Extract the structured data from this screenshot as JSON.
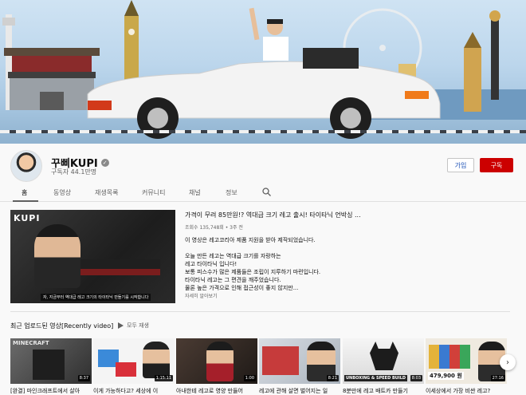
{
  "channel": {
    "name": "꾸삐KUPI",
    "verified_icon": "verified-check-icon",
    "subscribers": "구독자 44.1만명",
    "join_label": "가입",
    "subscribe_label": "구독"
  },
  "tabs": [
    {
      "label": "홈",
      "active": true
    },
    {
      "label": "동영상"
    },
    {
      "label": "재생목록"
    },
    {
      "label": "커뮤니티"
    },
    {
      "label": "채널"
    },
    {
      "label": "정보"
    }
  ],
  "search_icon": "search-icon",
  "featured": {
    "thumb_logo": "KUPI",
    "thumb_caption": "자, 지금부터 역대급 레고 크기의 타이타닉 만들기를 시작합니다",
    "title": "가격이 무려 85만원!? 역대급 크기 레고 출시! 타이타닉 언박싱 ...",
    "meta": "조회수 135,748회 • 3주 전",
    "description": "이 영상은 레고코리아 제품 지원을 받아 제작되었습니다.\n\n오늘 만든 레고는 역대급 크기를 자랑하는\n레고 타이타닉 입니다!\n보통 피스수가 많은 제품들은 조립이 지루하기 마련입니다.\n타이타닉 레고는 그 편견을 깨주었습니다.\n물론 높은 가격으로 인해 접근성이 좋지 않지만...",
    "more": "자세히 알아보기"
  },
  "recent": {
    "title": "최근 업로드된 영상[Recently video]",
    "play_all": "모두 재생",
    "play_icon": "play-icon",
    "next_icon": "chevron-right-icon",
    "videos": [
      {
        "title": "[완결] 마인크래프트에서 살아",
        "duration": "8:37",
        "thumb_text": "MINECRAFT"
      },
      {
        "title": "이게 가능하다고? 세상에 이",
        "duration": "1:15:11",
        "thumb_text": ""
      },
      {
        "title": "아내한테 레고로 영양 만들어",
        "duration": "1:00",
        "thumb_text": ""
      },
      {
        "title": "레고에 관해 살면 벌어지는 일",
        "duration": "8:21",
        "thumb_text": ""
      },
      {
        "title": "8분만에 레고 배트카 만들기",
        "duration": "8:03",
        "thumb_text": "UNBOXING & SPEED BUILD"
      },
      {
        "title": "이세상에서 가장 비싼 레고?",
        "duration": "27:16",
        "thumb_text": "479,900 원"
      }
    ]
  }
}
